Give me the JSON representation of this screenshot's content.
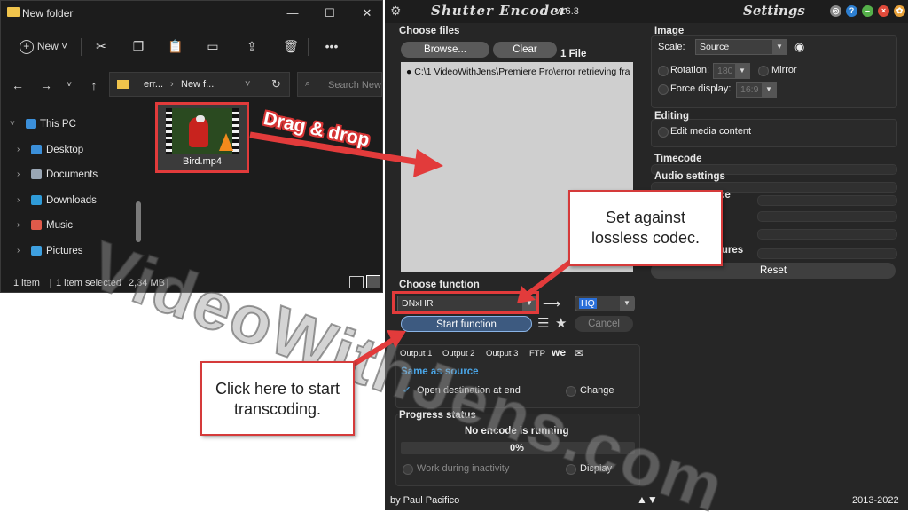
{
  "explorer": {
    "title": "New folder",
    "new_label": "New",
    "address": [
      "err...",
      "New f..."
    ],
    "search_placeholder": "Search New fo",
    "sidebar": [
      {
        "label": "This PC",
        "color": "#3b8fd9"
      },
      {
        "label": "Desktop",
        "color": "#3b8fd9"
      },
      {
        "label": "Documents",
        "color": "#9aa7b5"
      },
      {
        "label": "Downloads",
        "color": "#2f9bd8"
      },
      {
        "label": "Music",
        "color": "#e05a4a"
      },
      {
        "label": "Pictures",
        "color": "#3ea0e0"
      }
    ],
    "file_name": "Bird.mp4",
    "status": {
      "items": "1 item",
      "selected": "1 item selected",
      "size": "2,34 MB"
    }
  },
  "annotations": {
    "drag": "Drag & drop",
    "set_codec": [
      "Set against",
      "lossless codec."
    ],
    "click_start": [
      "Click here to start",
      "transcoding."
    ],
    "watermark": "VideoWithJens.com"
  },
  "shutter": {
    "app_name": "Shutter Encoder",
    "version": "v16.3",
    "settings_title": "Settings",
    "choose_files": "Choose files",
    "browse": "Browse...",
    "clear": "Clear",
    "file_count": "1 File",
    "file_path": "C:\\1 VideoWithJens\\Premiere Pro\\error retrieving fra",
    "choose_function": "Choose function",
    "function_value": "DNxHR",
    "profile_value": "HQ",
    "start": "Start function",
    "cancel": "Cancel",
    "outputs": [
      "Output 1",
      "Output 2",
      "Output 3",
      "FTP"
    ],
    "same_as_source": "Same as source",
    "open_dest": "Open destination at end",
    "change": "Change",
    "progress_title": "Progress status",
    "progress_status": "No encode is running",
    "progress_value": "0%",
    "work_inactivity": "Work during inactivity",
    "display": "Display",
    "image": "Image",
    "scale": "Scale:",
    "scale_value": "Source",
    "rotation": "Rotation:",
    "rotation_value": "180",
    "mirror": "Mirror",
    "force_display": "Force display:",
    "force_value": "16:9",
    "editing": "Editing",
    "edit_media": "Edit media content",
    "timecode": "Timecode",
    "audio": "Audio settings",
    "partial_ce": "ce",
    "partial_tures": "tures",
    "reset": "Reset",
    "author": "by Paul Pacifico",
    "years": "2013-2022"
  }
}
